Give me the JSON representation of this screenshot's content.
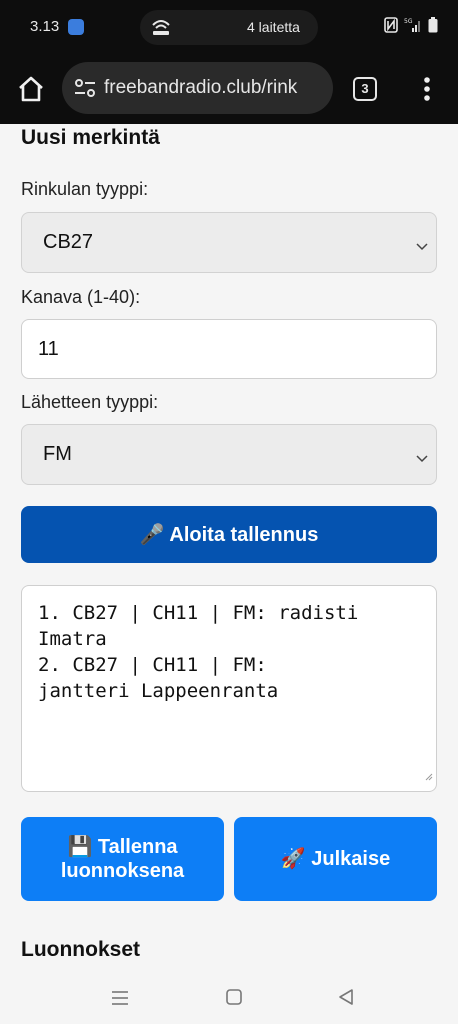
{
  "status_bar": {
    "time": "3.13",
    "devices_label": "4 laitetta"
  },
  "browser": {
    "url": "freebandradio.club/rink",
    "tab_count": "3"
  },
  "form": {
    "title": "Uusi merkintä",
    "band_type_label": "Rinkulan tyyppi:",
    "band_type_value": "CB27",
    "channel_label": "Kanava (1-40):",
    "channel_value": "11",
    "tx_type_label": "Lähetteen tyyppi:",
    "tx_type_value": "FM",
    "record_button": "🎤 Aloita tallennus",
    "log_lines": [
      "1. CB27 | CH11 | FM: radisti",
      "Imatra",
      "2. CB27 | CH11 | FM:",
      "jantteri Lappeenranta"
    ],
    "save_draft_line1": "💾 Tallenna",
    "save_draft_line2": "luonnoksena",
    "publish_button": "🚀 Julkaise"
  },
  "drafts": {
    "title": "Luonnokset"
  },
  "colors": {
    "record_button": "#0553b0",
    "action_button": "#0d7ef6"
  }
}
